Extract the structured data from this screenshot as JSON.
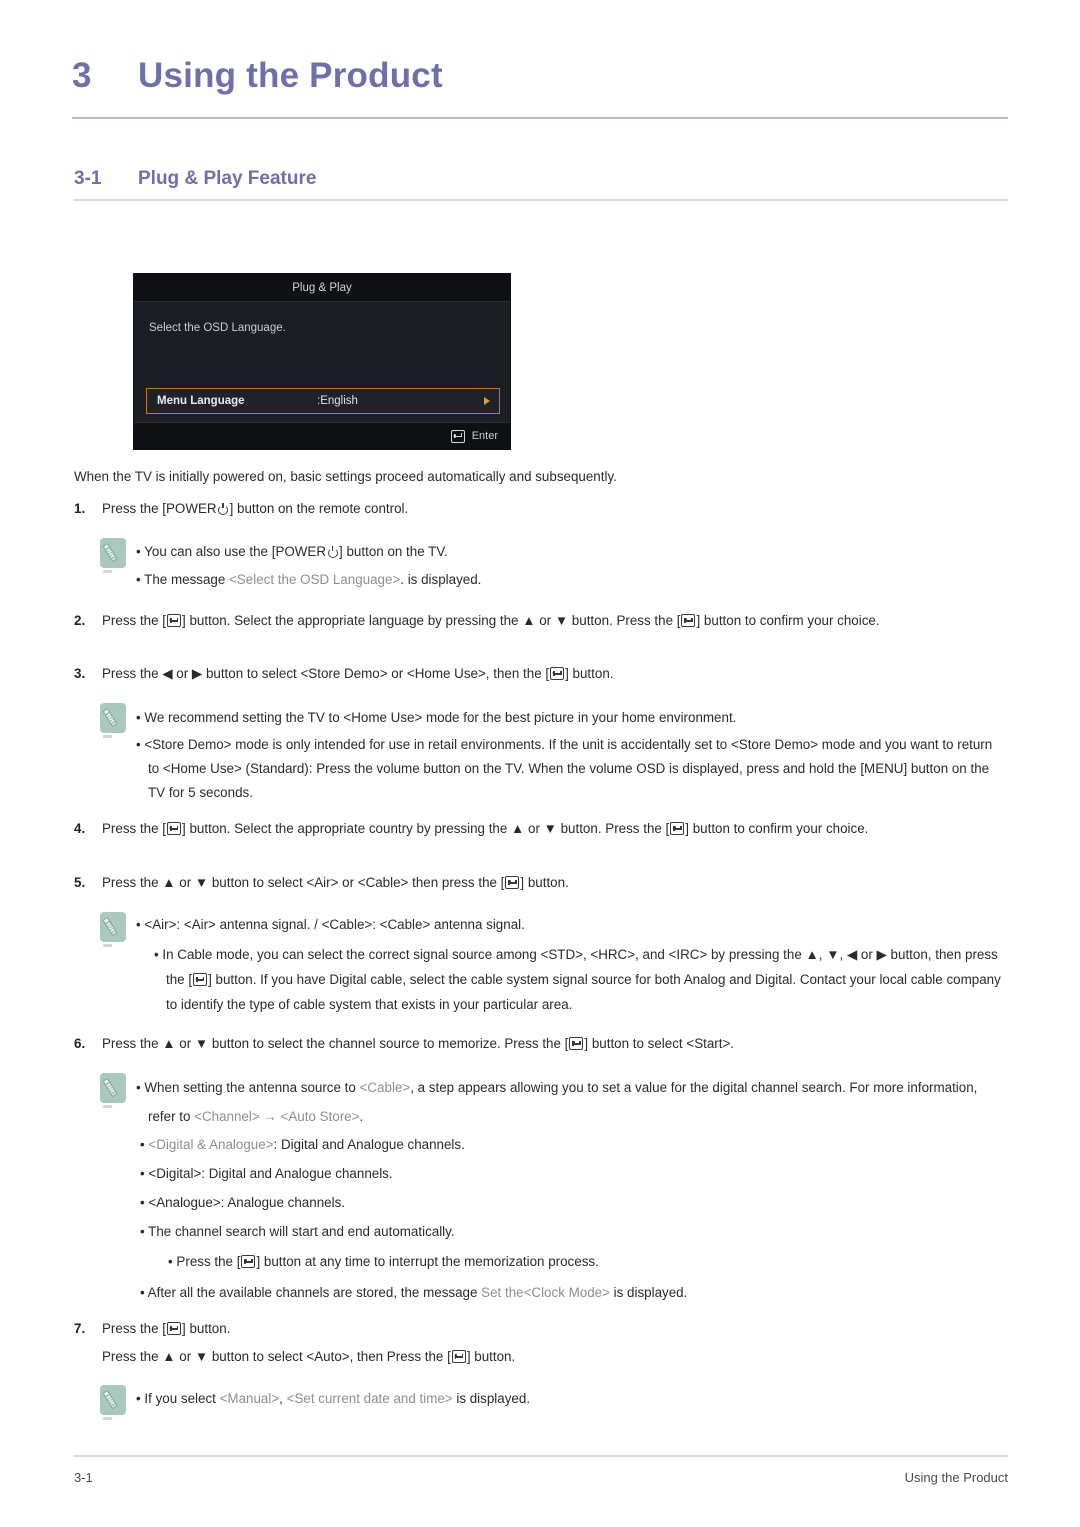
{
  "chapter": {
    "number": "3",
    "title": "Using the Product"
  },
  "section": {
    "number": "3-1",
    "title": "Plug & Play Feature"
  },
  "osd": {
    "title": "Plug & Play",
    "prompt": "Select the OSD Language.",
    "row_label": "Menu Language",
    "row_value": ":English",
    "arrow_icon": "right-triangle-icon",
    "footer_label": "Enter",
    "footer_icon": "enter-key-icon"
  },
  "intro": "When the TV is initially powered on, basic settings proceed automatically and subsequently.",
  "steps": {
    "s1": {
      "num": "1.",
      "a": "Press the [POWER",
      "b": "] button on the remote control."
    },
    "s2": {
      "num": "2.",
      "a": "Press the [",
      "b": "] button. Select the appropriate language by pressing the ▲ or ▼ button. Press the [",
      "c": "] button to confirm your choice."
    },
    "s3": {
      "num": "3.",
      "a": "Press the ◀ or ▶ button to select <Store Demo> or <Home Use>, then the [",
      "b": "] button."
    },
    "s4": {
      "num": "4.",
      "a": "Press the [",
      "b": "] button. Select the appropriate country by pressing the ▲ or ▼ button. Press the [",
      "c": "] button to confirm your choice."
    },
    "s5": {
      "num": "5.",
      "a": "Press the ▲ or ▼ button to select <Air> or <Cable> then press the [",
      "b": "] button."
    },
    "s6": {
      "num": "6.",
      "a": "Press the ▲ or ▼ button to select the channel source to memorize. Press the [",
      "b": "] button to select <Start>."
    },
    "s7": {
      "num": "7.",
      "a": "Press the [",
      "b": "] button.",
      "line2_a": "Press the ▲ or ▼ button to select <Auto>, then Press the [",
      "line2_b": "] button."
    }
  },
  "note1": {
    "line1_a": "You can also use the [POWER",
    "line1_b": "] button on the TV.",
    "line2_a": "The message ",
    "line2_gray": "<Select the OSD Language>",
    "line2_b": ". is displayed."
  },
  "note2": {
    "line1": "We recommend setting the TV to <Home Use> mode for the best picture in your home environment.",
    "line2": "<Store Demo> mode is only intended for use in retail environments. If the unit is accidentally set to <Store Demo> mode and you want to return to <Home Use> (Standard): Press the volume button on the TV. When the volume OSD is displayed, press and hold the [MENU] button on the TV for 5 seconds."
  },
  "note3": {
    "line1": "<Air>: <Air> antenna signal. / <Cable>: <Cable> antenna signal.",
    "line2_a": "In Cable mode, you can select the correct signal source among <STD>, <HRC>, and <IRC> by pressing the ▲, ▼, ◀ or ▶ button, then press the [",
    "line2_b": "] button. If you have Digital cable, select the cable system signal source for both Analog and Digital. Contact your local cable company to identify the type of cable system that exists in your particular area."
  },
  "note4": {
    "line_a": "When setting the antenna source to ",
    "gray1": "<Cable>",
    "line_b": ", a step appears allowing you to set a value for the digital channel search. For more information, refer to ",
    "gray2": "<Channel> → <Auto Store>",
    "line_c": "."
  },
  "bullets": {
    "b1_gray": "<Digital & Analogue>",
    "b1": ": Digital and Analogue channels.",
    "b2": "<Digital>: Digital and Analogue channels.",
    "b3": "<Analogue>: Analogue channels.",
    "b4": "The channel search will start and end automatically.",
    "b5_a": "Press the [",
    "b5_b": "] button at any time to interrupt the memorization process.",
    "b6_a": "After all the available channels are stored, the message ",
    "b6_gray": "Set the<Clock Mode>",
    "b6_b": " is displayed."
  },
  "note5": {
    "line_a": "If you select ",
    "gray1": "<Manual>",
    "line_b": ", ",
    "gray2": "<Set current date and time>",
    "line_c": " is displayed."
  },
  "footer": {
    "left": "3-1",
    "right": "Using the Product"
  },
  "colors": {
    "heading": "#6f6fab",
    "note_icon": "#a8c8c0",
    "osd_highlight": "#b8793a",
    "gray_text": "#8e8e93"
  }
}
